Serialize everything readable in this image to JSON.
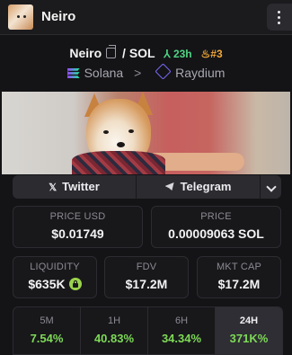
{
  "header": {
    "app_name": "Neiro",
    "avatar_icon": "dog-avatar-icon",
    "menu_icon": "kebab-menu-icon"
  },
  "pair": {
    "base": "Neiro",
    "separator": "/",
    "quote": "SOL",
    "age": "23h",
    "rank": "#3",
    "age_color": "#4fd483",
    "rank_color": "#f0a83a"
  },
  "chain": {
    "network": "Solana",
    "dex": "Raydium",
    "arrow": ">"
  },
  "social": {
    "twitter_label": "Twitter",
    "telegram_label": "Telegram"
  },
  "stats": {
    "price_usd_label": "PRICE USD",
    "price_usd": "$0.01749",
    "price_label": "PRICE",
    "price": "0.00009063 SOL",
    "liquidity_label": "LIQUIDITY",
    "liquidity": "$635K",
    "fdv_label": "FDV",
    "fdv": "$17.2M",
    "mktcap_label": "MKT CAP",
    "mktcap": "$17.2M"
  },
  "timeframes": [
    {
      "label": "5M",
      "change": "7.54%"
    },
    {
      "label": "1H",
      "change": "40.83%"
    },
    {
      "label": "6H",
      "change": "34.34%"
    },
    {
      "label": "24H",
      "change": "371K%"
    }
  ],
  "active_timeframe": "24H",
  "colors": {
    "positive": "#7ed957",
    "background": "#141417"
  }
}
